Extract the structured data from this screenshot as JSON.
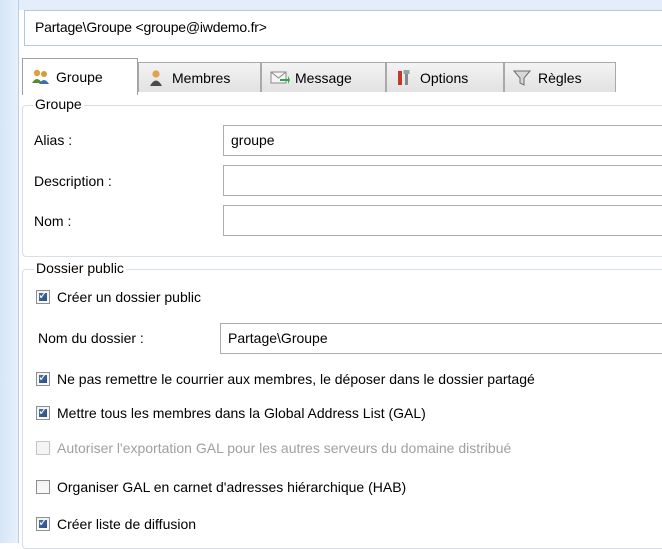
{
  "window": {
    "title": "Partage\\Groupe <groupe@iwdemo.fr>"
  },
  "tabs": [
    {
      "label": "Groupe",
      "icon": "group-icon",
      "active": true
    },
    {
      "label": "Membres",
      "icon": "members-icon",
      "active": false
    },
    {
      "label": "Message",
      "icon": "message-icon",
      "active": false
    },
    {
      "label": "Options",
      "icon": "options-icon",
      "active": false
    },
    {
      "label": "Règles",
      "icon": "filter-icon",
      "active": false
    }
  ],
  "groupe_section": {
    "legend": "Groupe",
    "alias_label": "Alias :",
    "alias_value": "groupe",
    "description_label": "Description :",
    "description_value": "",
    "nom_label": "Nom :",
    "nom_value": ""
  },
  "dossier_section": {
    "legend": "Dossier public",
    "create_public_folder": {
      "label": "Créer un dossier public",
      "checked": true
    },
    "folder_name_label": "Nom du dossier :",
    "folder_name_value": "Partage\\Groupe",
    "no_deliver": {
      "label": "Ne pas remettre le courrier aux membres, le déposer dans le dossier partagé",
      "checked": true
    },
    "gal_members": {
      "label": "Mettre tous les membres dans la Global Address List (GAL)",
      "checked": true
    },
    "gal_export": {
      "label": "Autoriser l'exportation GAL pour les autres serveurs du domaine distribué",
      "checked": false,
      "disabled": true
    },
    "hab": {
      "label": "Organiser GAL en carnet d'adresses hiérarchique (HAB)",
      "checked": false
    },
    "distribution_list": {
      "label": "Créer liste de diffusion",
      "checked": true
    }
  }
}
